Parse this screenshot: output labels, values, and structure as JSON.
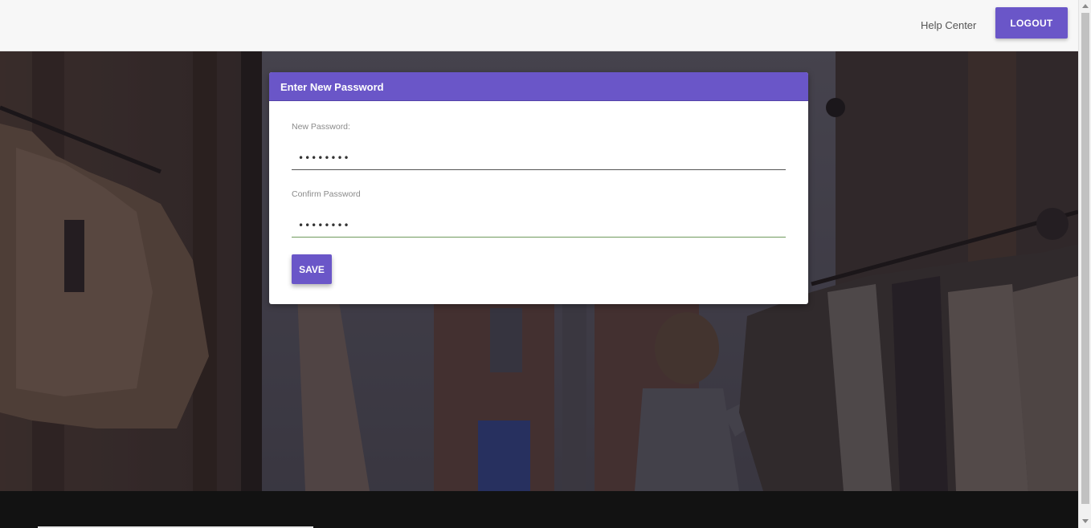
{
  "nav": {
    "help_label": "Help Center",
    "logout_label": "LOGOUT"
  },
  "card": {
    "title": "Enter New Password",
    "new_password_label": "New Password:",
    "new_password_value": "••••••••",
    "confirm_password_label": "Confirm Password",
    "confirm_password_value": "••••••••",
    "save_label": "SAVE"
  },
  "colors": {
    "accent": "#6a56c8",
    "topbar": "#f7f7f7",
    "confirm_underline": "#6f9a5c"
  }
}
